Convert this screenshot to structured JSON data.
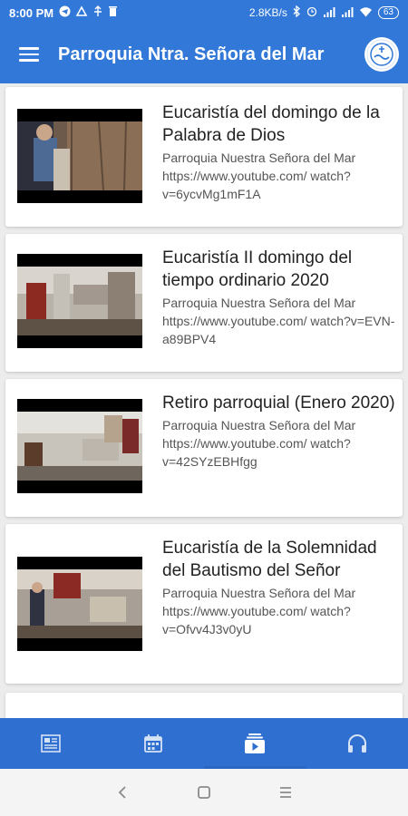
{
  "status_bar": {
    "time": "8:00 PM",
    "speed": "2.8KB/s",
    "battery": "63"
  },
  "app_bar": {
    "title": "Parroquia Ntra. Señora del Mar",
    "logo_text": "PNSM"
  },
  "videos": [
    {
      "title": "Eucaristía del domingo de la Palabra de Dios",
      "channel": "Parroquia Nuestra Señora del Mar",
      "url": "https://www.youtube.com/ watch?v=6ycvMg1mF1A"
    },
    {
      "title": "Eucaristía II domingo del tiempo ordinario 2020",
      "channel": "Parroquia Nuestra Señora del Mar",
      "url": "https://www.youtube.com/ watch?v=EVN-a89BPV4"
    },
    {
      "title": "Retiro parroquial (Enero 2020)",
      "channel": "Parroquia Nuestra Señora del Mar",
      "url": "https://www.youtube.com/ watch?v=42SYzEBHfgg"
    },
    {
      "title": "Eucaristía de la Solemnidad del Bautismo del Señor",
      "channel": "Parroquia Nuestra Señora del Mar",
      "url": "https://www.youtube.com/ watch?v=Ofvv4J3v0yU"
    }
  ],
  "bottom_nav": {
    "items": [
      {
        "icon": "news-icon"
      },
      {
        "icon": "calendar-icon"
      },
      {
        "icon": "video-playlist-icon",
        "active": true
      },
      {
        "icon": "headphones-icon"
      }
    ]
  },
  "colors": {
    "primary": "#3278d8",
    "nav": "#2f6fd0",
    "background": "#ececec"
  }
}
